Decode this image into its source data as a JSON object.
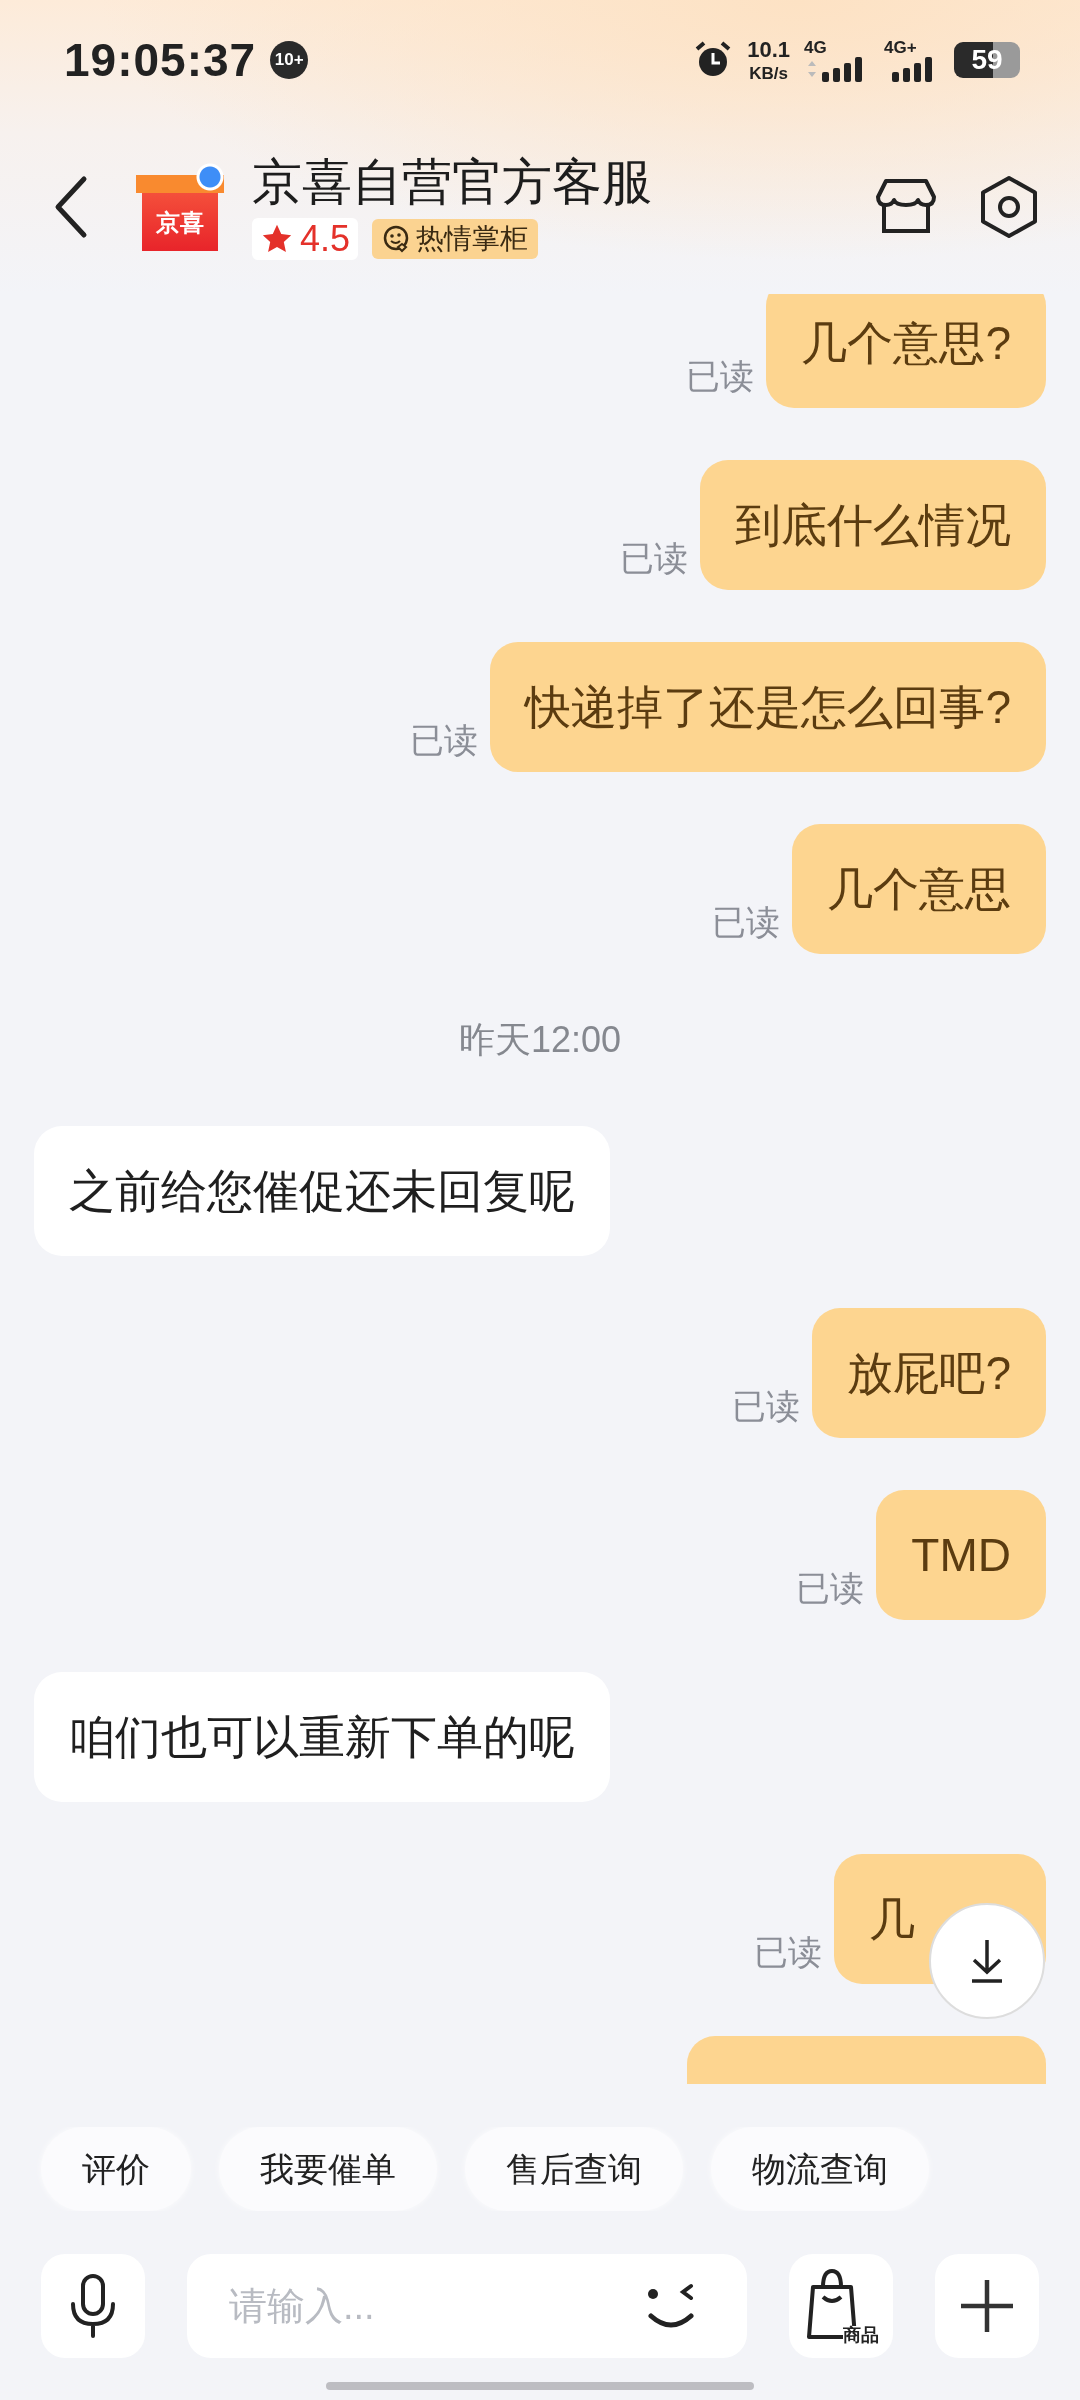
{
  "status_bar": {
    "time": "19:05:37",
    "notification_badge": "10+",
    "network_speed": "10.1",
    "network_speed_unit": "KB/s",
    "sim1": "4G",
    "sim2": "4G+",
    "battery": "59"
  },
  "header": {
    "logo_text": "京喜",
    "title": "京喜自营官方客服",
    "rating": "4.5",
    "badge": "热情掌柜"
  },
  "messages": [
    {
      "kind": "bubble",
      "outgoing": true,
      "text": "几个意思?",
      "status": "已读"
    },
    {
      "kind": "bubble",
      "outgoing": true,
      "text": "到底什么情况",
      "status": "已读"
    },
    {
      "kind": "bubble",
      "outgoing": true,
      "text": "快递掉了还是怎么回事?",
      "status": "已读"
    },
    {
      "kind": "bubble",
      "outgoing": true,
      "text": "几个意思",
      "status": "已读"
    },
    {
      "kind": "time",
      "text": "昨天12:00"
    },
    {
      "kind": "bubble",
      "outgoing": false,
      "text": "之前给您催促还未回复呢"
    },
    {
      "kind": "bubble",
      "outgoing": true,
      "text": "放屁吧?",
      "status": "已读"
    },
    {
      "kind": "bubble",
      "outgoing": true,
      "text": "TMD",
      "status": "已读"
    },
    {
      "kind": "bubble",
      "outgoing": false,
      "text": "咱们也可以重新下单的呢"
    },
    {
      "kind": "bubble",
      "outgoing": true,
      "text": "几",
      "status": "已读",
      "partly_covered": true
    },
    {
      "kind": "clipped",
      "outgoing": true
    }
  ],
  "quick_replies": [
    {
      "label": "评价"
    },
    {
      "label": "我要催单"
    },
    {
      "label": "售后查询"
    },
    {
      "label": "物流查询"
    }
  ],
  "input": {
    "placeholder": "请输入..."
  },
  "goods_button": {
    "label": "商品"
  }
}
